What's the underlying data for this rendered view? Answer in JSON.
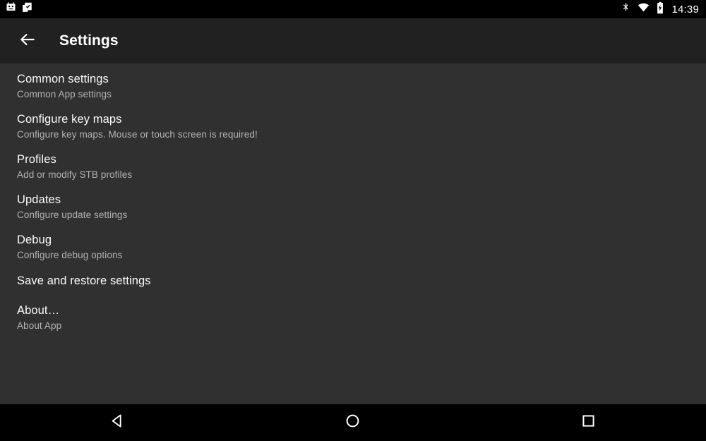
{
  "status_bar": {
    "left_icons": [
      {
        "name": "android-robot-icon",
        "label": "Android app notification"
      },
      {
        "name": "clipboard-check-icon",
        "label": "Clipboard task notification"
      }
    ],
    "right_icons": [
      {
        "name": "bluetooth-icon",
        "label": "Bluetooth on"
      },
      {
        "name": "wifi-icon",
        "label": "Wi-Fi connected"
      },
      {
        "name": "battery-charging-icon",
        "label": "Battery charging"
      }
    ],
    "clock": "14:39"
  },
  "toolbar": {
    "back_icon": "arrow-left-icon",
    "title": "Settings"
  },
  "preferences": [
    {
      "title": "Common settings",
      "summary": "Common App settings"
    },
    {
      "title": "Configure key maps",
      "summary": "Configure key maps. Mouse or touch screen is required!"
    },
    {
      "title": "Profiles",
      "summary": "Add or modify STB profiles"
    },
    {
      "title": "Updates",
      "summary": "Configure update settings"
    },
    {
      "title": "Debug",
      "summary": "Configure debug options"
    },
    {
      "title": "Save and restore settings",
      "summary": ""
    },
    {
      "title": "About…",
      "summary": "About App"
    }
  ],
  "nav_bar": {
    "back": "back-triangle-icon",
    "home": "home-circle-icon",
    "recents": "recents-square-icon"
  },
  "colors": {
    "status_bar_bg": "#000000",
    "toolbar_bg": "#212121",
    "content_bg": "#303030",
    "nav_bar_bg": "#000000",
    "title_text": "#fafafa",
    "summary_text": "#b3b3b3",
    "icon_white": "#ffffff"
  }
}
